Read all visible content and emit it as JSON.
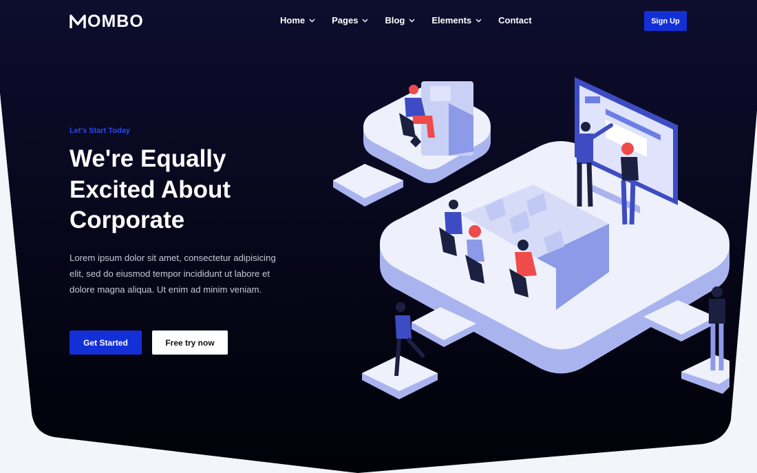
{
  "brand": {
    "logo_text": "OMBO",
    "logo_icon": "m-logo-icon"
  },
  "nav": {
    "items": [
      {
        "label": "Home",
        "has_dropdown": true
      },
      {
        "label": "Pages",
        "has_dropdown": true
      },
      {
        "label": "Blog",
        "has_dropdown": true
      },
      {
        "label": "Elements",
        "has_dropdown": true
      },
      {
        "label": "Contact",
        "has_dropdown": false
      }
    ],
    "signup_label": "Sign Up"
  },
  "hero": {
    "eyebrow": "Let's Start Today",
    "headline": "We're Equally Excited About Corporate",
    "body": "Lorem ipsum dolor sit amet, consectetur adipisicing elit, sed do eiusmod tempor incididunt ut labore et dolore magna aliqua. Ut enim ad minim veniam.",
    "primary_button": "Get Started",
    "secondary_button": "Free try now"
  },
  "colors": {
    "hero_dark": "#030315",
    "accent_blue": "#1330d6",
    "platform_light": "#e8ebfb",
    "platform_mid": "#a9b4ef",
    "figure_red": "#ef4b4b"
  }
}
